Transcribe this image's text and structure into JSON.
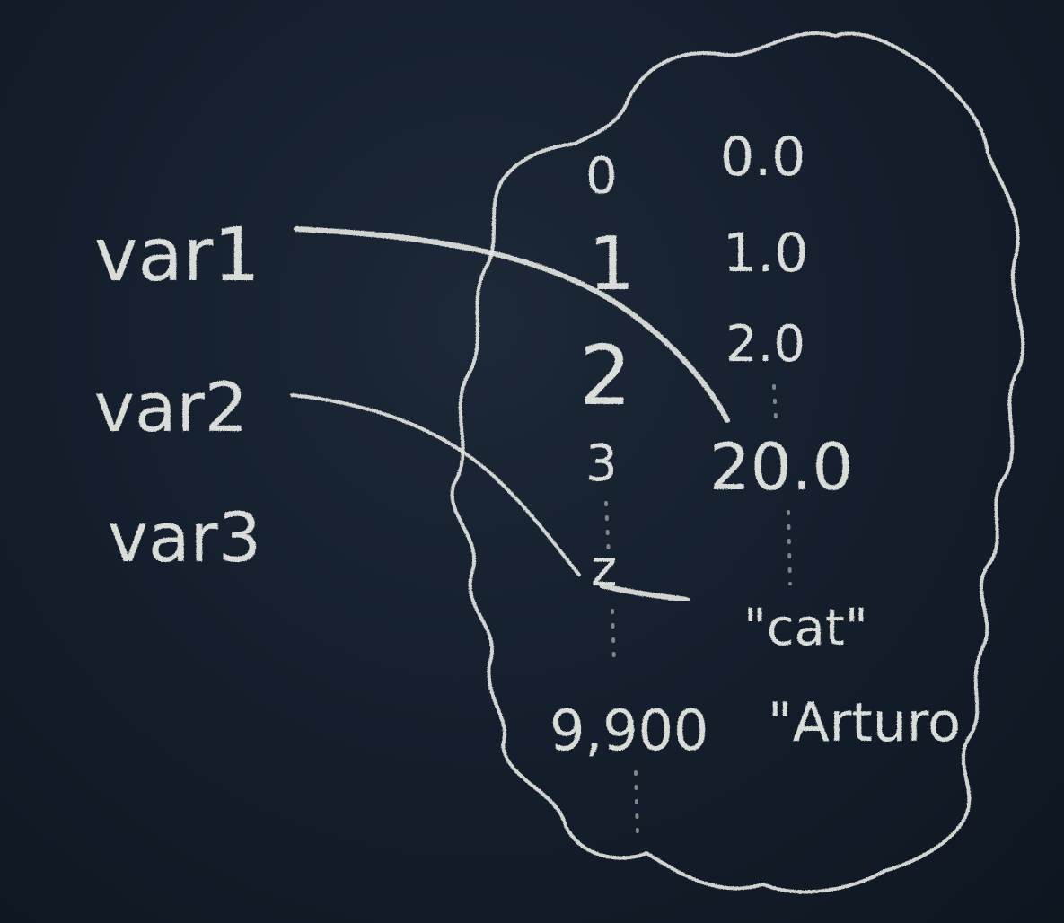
{
  "variables": [
    "var1",
    "var2",
    "var3"
  ],
  "addresses": [
    "0",
    "1",
    "2",
    "3",
    "z",
    "9,900"
  ],
  "values": [
    "0.0",
    "1.0",
    "2.0",
    "20.0",
    "\"cat\"",
    "\"Arturo"
  ],
  "colors": {
    "board": "#151f2d",
    "chalk": "#e9ebe6"
  }
}
